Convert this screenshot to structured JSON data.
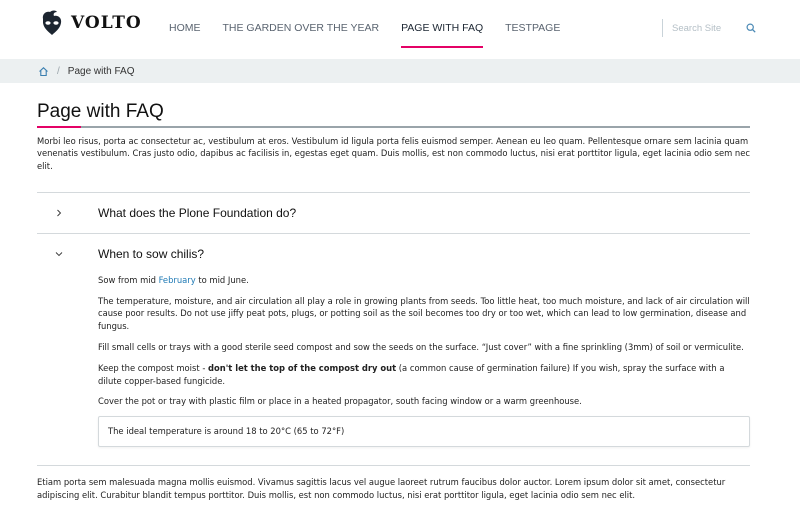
{
  "header": {
    "logo_text": "VOLTO",
    "nav": [
      {
        "label": "HOME",
        "active": false
      },
      {
        "label": "THE GARDEN OVER THE YEAR",
        "active": false
      },
      {
        "label": "PAGE WITH FAQ",
        "active": true
      },
      {
        "label": "TESTPAGE",
        "active": false
      }
    ],
    "search_placeholder": "Search Site",
    "search_icon": "search-icon"
  },
  "breadcrumb": {
    "home_icon": "home-icon",
    "separator": "/",
    "current": "Page with FAQ"
  },
  "main": {
    "title": "Page with FAQ",
    "intro": "Morbi leo risus, porta ac consectetur ac, vestibulum at eros. Vestibulum id ligula porta felis euismod semper. Aenean eu leo quam. Pellentesque ornare sem lacinia quam venenatis vestibulum. Cras justo odio, dapibus ac facilisis in, egestas eget quam. Duis mollis, est non commodo luctus, nisi erat porttitor ligula, eget lacinia odio sem nec elit.",
    "faq": [
      {
        "question": "What does the Plone Foundation do?",
        "expanded": false,
        "icon": "chevron-right-icon"
      },
      {
        "question": "When to sow chilis?",
        "expanded": true,
        "icon": "chevron-down-icon",
        "p1_before": "Sow from mid ",
        "p1_link": "February",
        "p1_after": " to mid June.",
        "p2": "The temperature, moisture, and air circulation all play a role in growing plants from seeds. Too little heat, too much moisture, and lack of air circulation will cause poor results. Do not use jiffy peat pots, plugs, or potting soil as the soil becomes too dry or too wet, which can lead to low germination, disease and fungus.",
        "p3": "Fill small cells or trays with a good sterile seed compost and sow the seeds on the surface. “Just cover” with a fine sprinkling (3mm) of soil or vermiculite.",
        "p4_before": "Keep the compost moist - ",
        "p4_bold": "don't let the top of the compost dry out",
        "p4_after": " (a common cause of germination failure) If you wish, spray the surface with a dilute copper-based fungicide.",
        "p5": "Cover the pot or tray with plastic film or place in a heated propagator, south facing window or a warm greenhouse.",
        "callout": "The ideal temperature is around 18 to 20°C (65 to 72°F)"
      }
    ],
    "outro": "Etiam porta sem malesuada magna mollis euismod. Vivamus sagittis lacus vel augue laoreet rutrum faucibus dolor auctor. Lorem ipsum dolor sit amet, consectetur adipiscing elit. Curabitur blandit tempus porttitor. Duis mollis, est non commodo luctus, nisi erat porttitor ligula, eget lacinia odio sem nec elit."
  },
  "colors": {
    "accent": "#e40166",
    "link": "#1f7ab5",
    "breadcrumb_bg": "#ecf0f1",
    "border": "#d4d9dc"
  }
}
